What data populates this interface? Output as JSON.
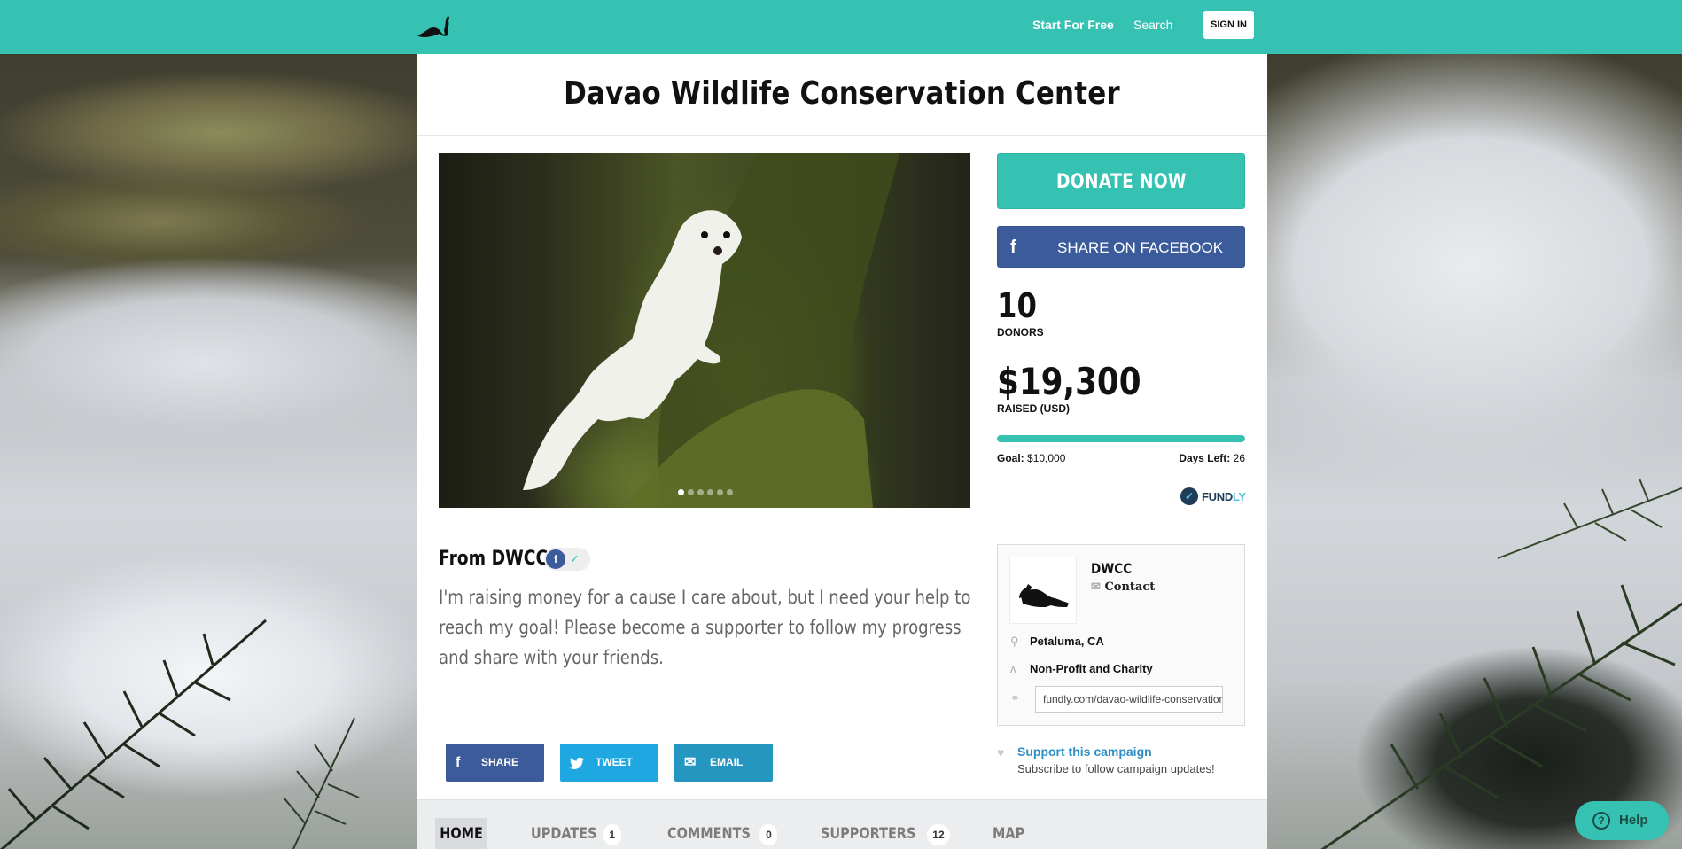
{
  "nav": {
    "start_label": "Start For Free",
    "search_label": "Search",
    "signin_label": "SIGN IN"
  },
  "campaign": {
    "title": "Davao Wildlife Conservation Center",
    "donate_label": "DONATE NOW",
    "fb_share_label": "SHARE ON FACEBOOK",
    "donors_count": "10",
    "donors_label": "DONORS",
    "raised_amount": "$19,300",
    "raised_label": "RAISED (USD)",
    "progress_percent": 100,
    "goal_label": "Goal:",
    "goal_value": "$10,000",
    "days_label": "Days Left:",
    "days_value": "26",
    "fundly_brand": "FUND",
    "fundly_brand_ly": "LY",
    "slides_total": 6,
    "slides_active": 1
  },
  "story": {
    "from_label": "From DWCC",
    "text": "I'm raising money for a cause I care about, but I need your help to reach my goal! Please become a supporter to follow my progress and share with your friends.",
    "share_label": "SHARE",
    "tweet_label": "TWEET",
    "email_label": "EMAIL"
  },
  "organizer": {
    "name": "DWCC",
    "contact_label": "Contact",
    "location": "Petaluma, CA",
    "category": "Non-Profit and Charity",
    "url": "fundly.com/davao-wildlife-conservation-center"
  },
  "support": {
    "link_label": "Support this campaign",
    "subtext": "Subscribe to follow campaign updates!"
  },
  "tabs": [
    {
      "label": "HOME"
    },
    {
      "label": "UPDATES",
      "count": "1"
    },
    {
      "label": "COMMENTS",
      "count": "0"
    },
    {
      "label": "SUPPORTERS",
      "count": "12"
    },
    {
      "label": "MAP"
    }
  ],
  "help": {
    "label": "Help"
  },
  "colors": {
    "brand": "#35c2b2",
    "facebook": "#3b5b9b",
    "twitter": "#1ea7e1",
    "email": "#2596c0"
  },
  "icons": [
    "ferret-logo-icon",
    "facebook-icon",
    "twitter-icon",
    "email-icon",
    "envelope-icon",
    "map-pin-icon",
    "ribbon-icon",
    "link-icon",
    "heart-icon",
    "question-icon",
    "check-icon"
  ]
}
